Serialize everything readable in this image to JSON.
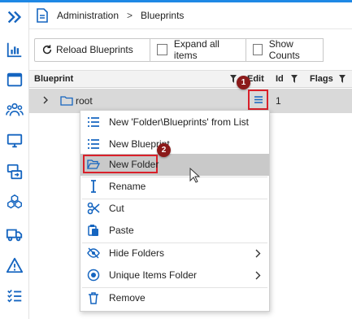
{
  "breadcrumb": {
    "items": [
      "Administration",
      "Blueprints"
    ],
    "separator": ">"
  },
  "toolbar": {
    "reload_label": "Reload Blueprints",
    "expand_label": "Expand all items",
    "counts_label": "Show Counts"
  },
  "grid": {
    "columns": [
      "Blueprint",
      "Edit",
      "Id",
      "Flags"
    ],
    "rows": [
      {
        "name": "root",
        "id": "1"
      }
    ]
  },
  "context_menu": {
    "items": [
      {
        "label": "New 'Folder\\Blueprints' from List",
        "icon": "list-icon"
      },
      {
        "label": "New Blueprint",
        "icon": "list-icon"
      },
      {
        "label": "New Folder",
        "icon": "folder-open-icon"
      },
      {
        "label": "Rename",
        "icon": "text-cursor-icon"
      },
      {
        "label": "Cut",
        "icon": "scissors-icon"
      },
      {
        "label": "Paste",
        "icon": "paste-icon"
      },
      {
        "label": "Hide Folders",
        "icon": "eye-off-icon"
      },
      {
        "label": "Unique Items Folder",
        "icon": "target-icon"
      },
      {
        "label": "Remove",
        "icon": "trash-icon"
      }
    ]
  },
  "callouts": [
    "1",
    "2"
  ],
  "colors": {
    "accent": "#1e88e5",
    "highlight": "#d9202a",
    "callout": "#8b1a1a",
    "icon": "#1565c0"
  }
}
